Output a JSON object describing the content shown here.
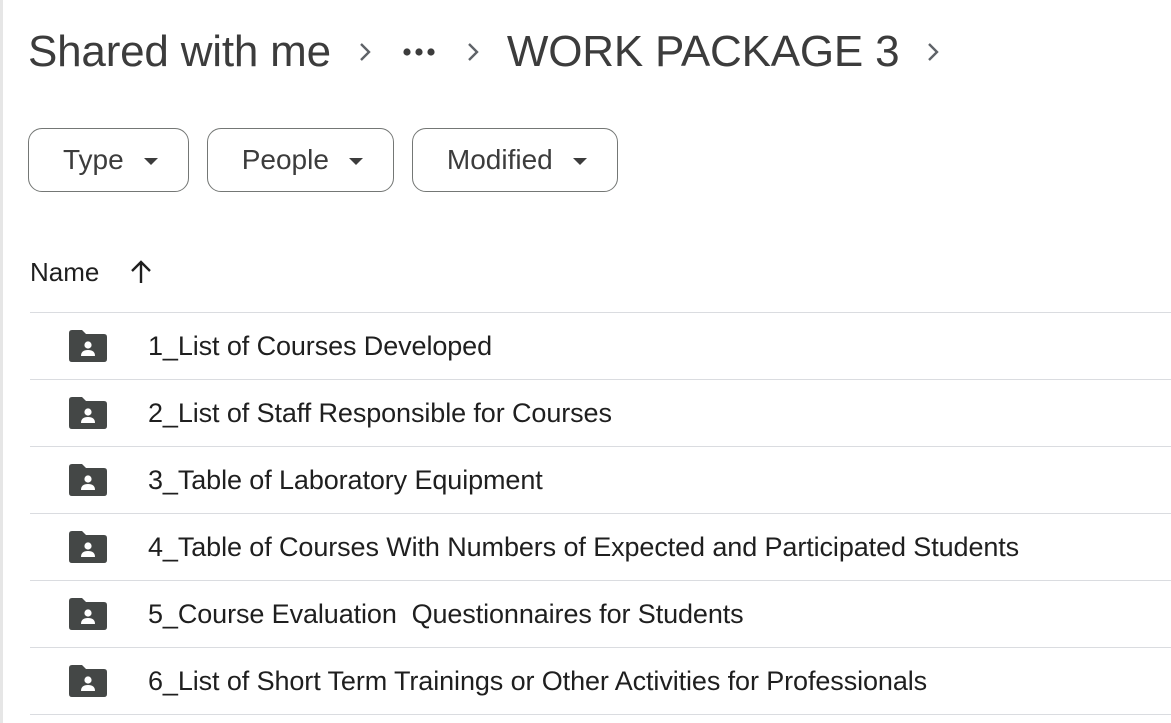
{
  "breadcrumb": {
    "root": "Shared with me",
    "more_label": "•••",
    "current": "WORK PACKAGE 3"
  },
  "filters": [
    {
      "label": "Type"
    },
    {
      "label": "People"
    },
    {
      "label": "Modified"
    }
  ],
  "columns": {
    "name": "Name",
    "sort_direction": "ascending"
  },
  "files": [
    {
      "name": "1_List of Courses Developed",
      "type": "shared-folder"
    },
    {
      "name": "2_List of Staff Responsible for Courses",
      "type": "shared-folder"
    },
    {
      "name": "3_Table of Laboratory Equipment",
      "type": "shared-folder"
    },
    {
      "name": "4_Table of Courses With Numbers of Expected and Participated Students",
      "type": "shared-folder"
    },
    {
      "name": "5_Course Evaluation  Questionnaires for Students",
      "type": "shared-folder"
    },
    {
      "name": "6_List of Short Term Trainings or Other Activities for Professionals",
      "type": "shared-folder"
    }
  ],
  "colors": {
    "text": "#1f1f1f",
    "muted": "#5f6368",
    "icon": "#444746",
    "divider": "#dadce0",
    "chip_border": "#747775"
  }
}
